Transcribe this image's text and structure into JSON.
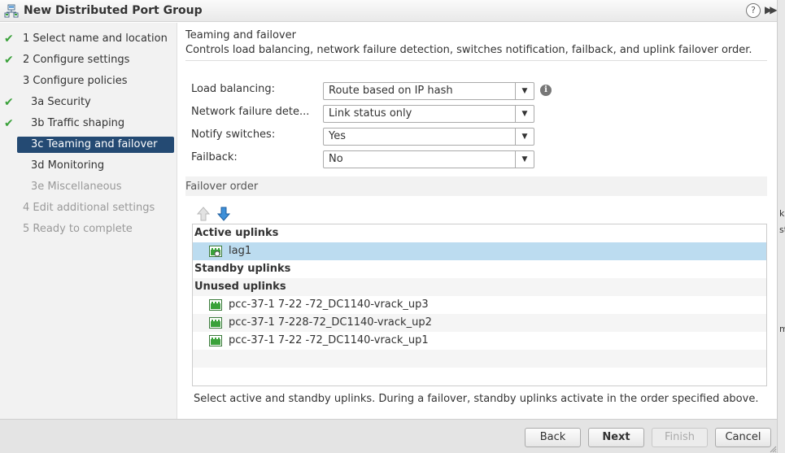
{
  "window": {
    "title": "New Distributed Port Group",
    "help_glyph": "?",
    "expand_glyph": "▶▶"
  },
  "edge_fragments": [
    "k",
    "st",
    "m"
  ],
  "steps": [
    {
      "label": "1  Select name and location",
      "done": true
    },
    {
      "label": "2  Configure settings",
      "done": true
    },
    {
      "label": "3  Configure policies",
      "done": false
    },
    {
      "label": "3a  Security",
      "done": true
    },
    {
      "label": "3b  Traffic shaping",
      "done": true
    },
    {
      "label": "3c  Teaming and failover",
      "selected": true
    },
    {
      "label": "3d  Monitoring"
    },
    {
      "label": "3e  Miscellaneous",
      "disabled": true
    },
    {
      "label": "4  Edit additional settings",
      "disabled": true
    },
    {
      "label": "5  Ready to complete",
      "disabled": true
    }
  ],
  "check_glyph": "✔",
  "header": {
    "title": "Teaming and failover",
    "description": "Controls load balancing, network failure detection, switches notification, failback, and uplink failover order."
  },
  "form": {
    "load_balancing": {
      "label": "Load balancing:",
      "value": "Route based on IP hash"
    },
    "network_failure": {
      "label": "Network failure dete...",
      "value": "Link status only"
    },
    "notify_switches": {
      "label": "Notify switches:",
      "value": "Yes"
    },
    "failback": {
      "label": "Failback:",
      "value": "No"
    },
    "info_glyph": "i",
    "dropdown_glyph": "▼"
  },
  "failover": {
    "section_label": "Failover order",
    "groups": {
      "active": "Active uplinks",
      "standby": "Standby uplinks",
      "unused": "Unused uplinks"
    },
    "active_items": [
      "lag1"
    ],
    "unused_items": [
      "pcc-37-1  7-22  -72_DC1140-vrack_up3",
      "pcc-37-1  7-228-72_DC1140-vrack_up2",
      "pcc-37-1  7-22  -72_DC1140-vrack_up1"
    ]
  },
  "help_text": "Select active and standby uplinks. During a failover, standby uplinks activate in the order specified above.",
  "buttons": {
    "back": "Back",
    "next": "Next",
    "finish": "Finish",
    "cancel": "Cancel"
  },
  "colors": {
    "selected_step": "#244a73",
    "selected_row": "#bcdcf0",
    "check": "#3aa13a"
  }
}
